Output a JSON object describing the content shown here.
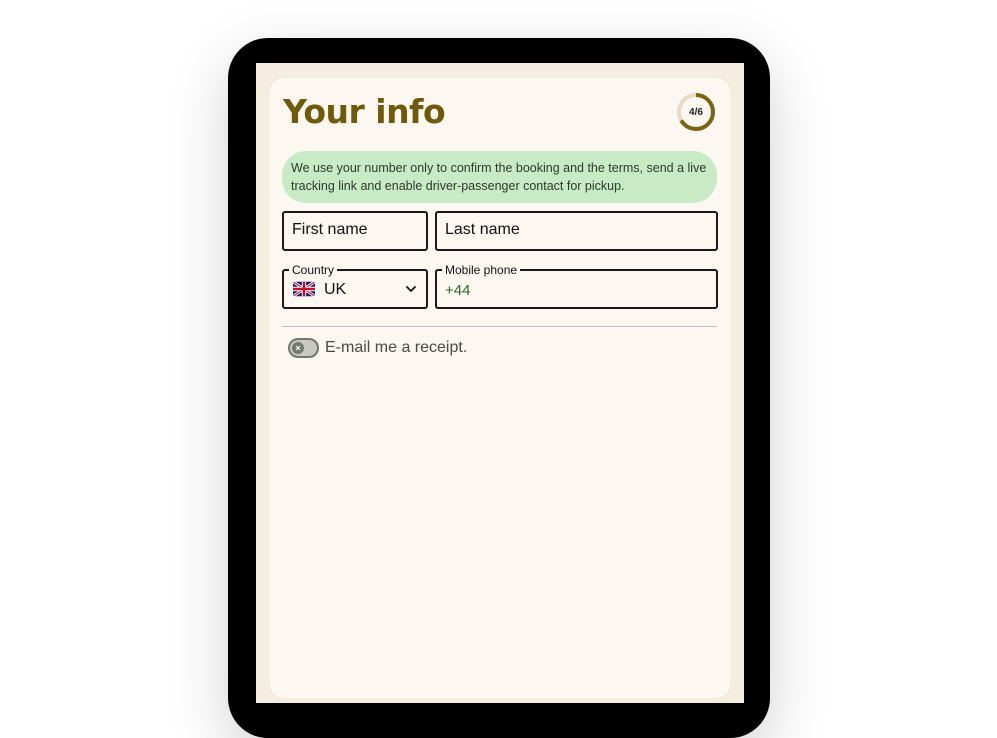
{
  "page": {
    "title": "Your info",
    "progress": {
      "label": "4/6",
      "current": 4,
      "total": 6,
      "color": "#7a6410"
    }
  },
  "notice": {
    "line1": "We use your number only to confirm the booking and the terms, send a live",
    "line2": "tracking link and enable driver-passenger contact for pickup."
  },
  "form": {
    "first_name_placeholder": "First name",
    "last_name_placeholder": "Last name",
    "country": {
      "label": "Country",
      "value": "UK",
      "flag_icon": "uk-flag-icon"
    },
    "phone": {
      "label": "Mobile phone",
      "value": "+44"
    }
  },
  "receipt_toggle": {
    "label": "E-mail me a receipt.",
    "checked": false
  },
  "colors": {
    "title": "#6e5a08",
    "notice_bg": "#c8ebc6",
    "card_bg": "#fcf7f0",
    "screen_bg": "#f4ede0"
  }
}
